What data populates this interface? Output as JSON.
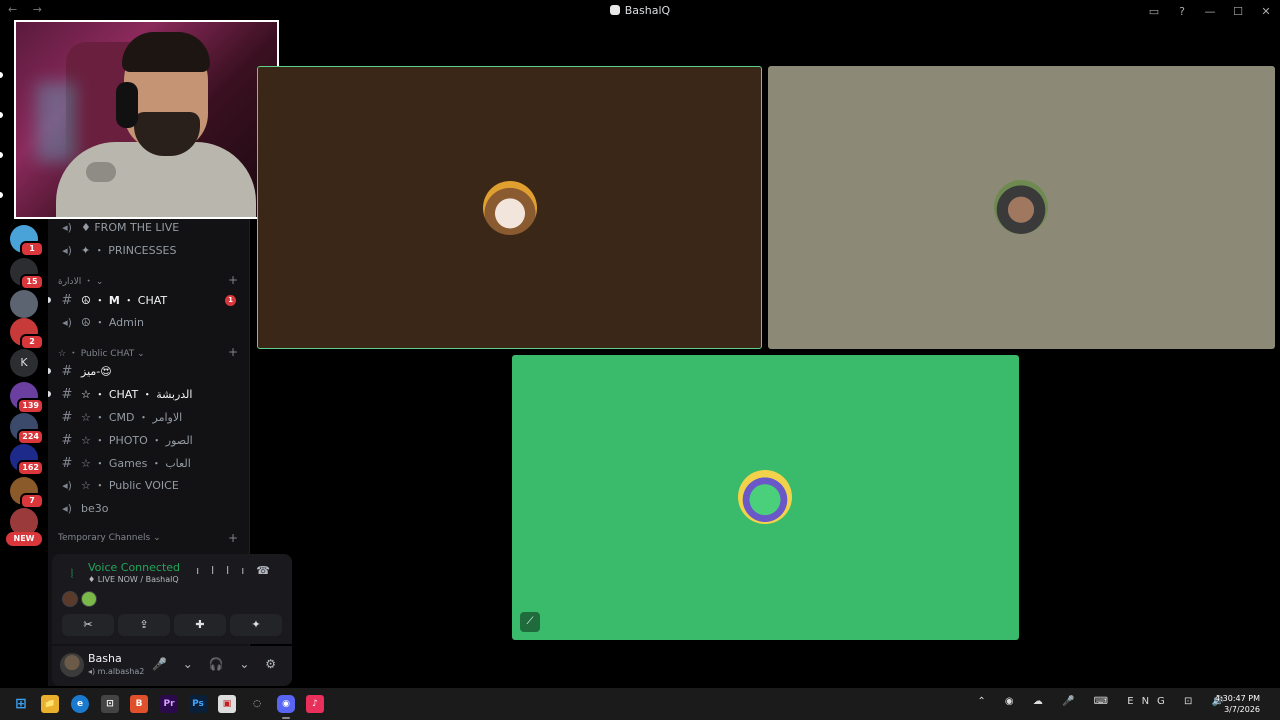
{
  "window": {
    "title": "BashalQ",
    "nav": "← →",
    "controls": [
      "▭",
      "?",
      "—",
      "☐",
      "✕"
    ]
  },
  "rail": {
    "new_badge": "NEW",
    "servers": [
      {
        "name": "server-1",
        "badge": "1",
        "color": "#4aa3d8"
      },
      {
        "name": "server-2",
        "badge": "15",
        "color": "#2b2d31"
      },
      {
        "name": "server-3",
        "badge": "",
        "color": "#5b6470"
      },
      {
        "name": "server-4",
        "badge": "2",
        "color": "#c83a3a"
      },
      {
        "name": "server-5",
        "badge": "",
        "letter": "K",
        "color": "#2b2d31"
      },
      {
        "name": "server-6",
        "badge": "139",
        "color": "#6b3fa0"
      },
      {
        "name": "server-7",
        "badge": "224",
        "color": "#3b4a6b"
      },
      {
        "name": "server-8",
        "badge": "162",
        "color": "#1e2a8a"
      },
      {
        "name": "server-9",
        "badge": "7",
        "color": "#8a5a2a"
      },
      {
        "name": "server-10",
        "badge": "",
        "color": "#9a3a3a"
      }
    ]
  },
  "channels": {
    "live": "♦ FROM THE LIVE",
    "princesses": "✦ ・ PRINCESSES",
    "cat_admin": "الادارة ・ ⌄",
    "chat_m": "☮ ・ 𝗠 ・ CHAT",
    "chat_m_badge": "1",
    "admin": "☮ ・ Admin",
    "cat_public": "☆ ・ Public CHAT ⌄",
    "mizz": "ميز-😍",
    "chat_ar": "☆ ・ CHAT ・ الدربشة",
    "cmd": "☆ ・ CMD ・ الاوامر",
    "photo": "☆ ・ PHOTO ・ الصور",
    "games": "☆ ・ Games ・ العاب",
    "public_voice": "☆ ・ Public VOICE",
    "be3o": "be3o",
    "cat_temp": "Temporary Channels ⌄"
  },
  "voice": {
    "title": "Voice Connected",
    "subtitle": "♦ LIVE NOW / BashalQ",
    "buttons": [
      "✂",
      "⇪",
      "✚",
      "✦"
    ]
  },
  "user": {
    "name": "Basha",
    "status": "◂) m.albasha2",
    "controls": "🎤 ⌄ 🎧 ⌄ ⚙"
  },
  "tiles": [
    {
      "name": "participant-1",
      "bg": "#3b2718",
      "speaking": true
    },
    {
      "name": "participant-2",
      "bg": "#8c8a76",
      "speaking": false
    },
    {
      "name": "participant-3",
      "bg": "#3aba6b",
      "speaking": false
    }
  ],
  "taskbar": {
    "apps": [
      "⊞",
      "📁",
      "e",
      "⊡",
      "B",
      "Pr",
      "Ps",
      "▣",
      "◌",
      "◉",
      "♪"
    ],
    "tray": "⌃ ◉ ☁ 🎤 ⌨ ENG ⊡ 🔊",
    "time": "4:30:47 PM",
    "date": "3/7/2026"
  }
}
